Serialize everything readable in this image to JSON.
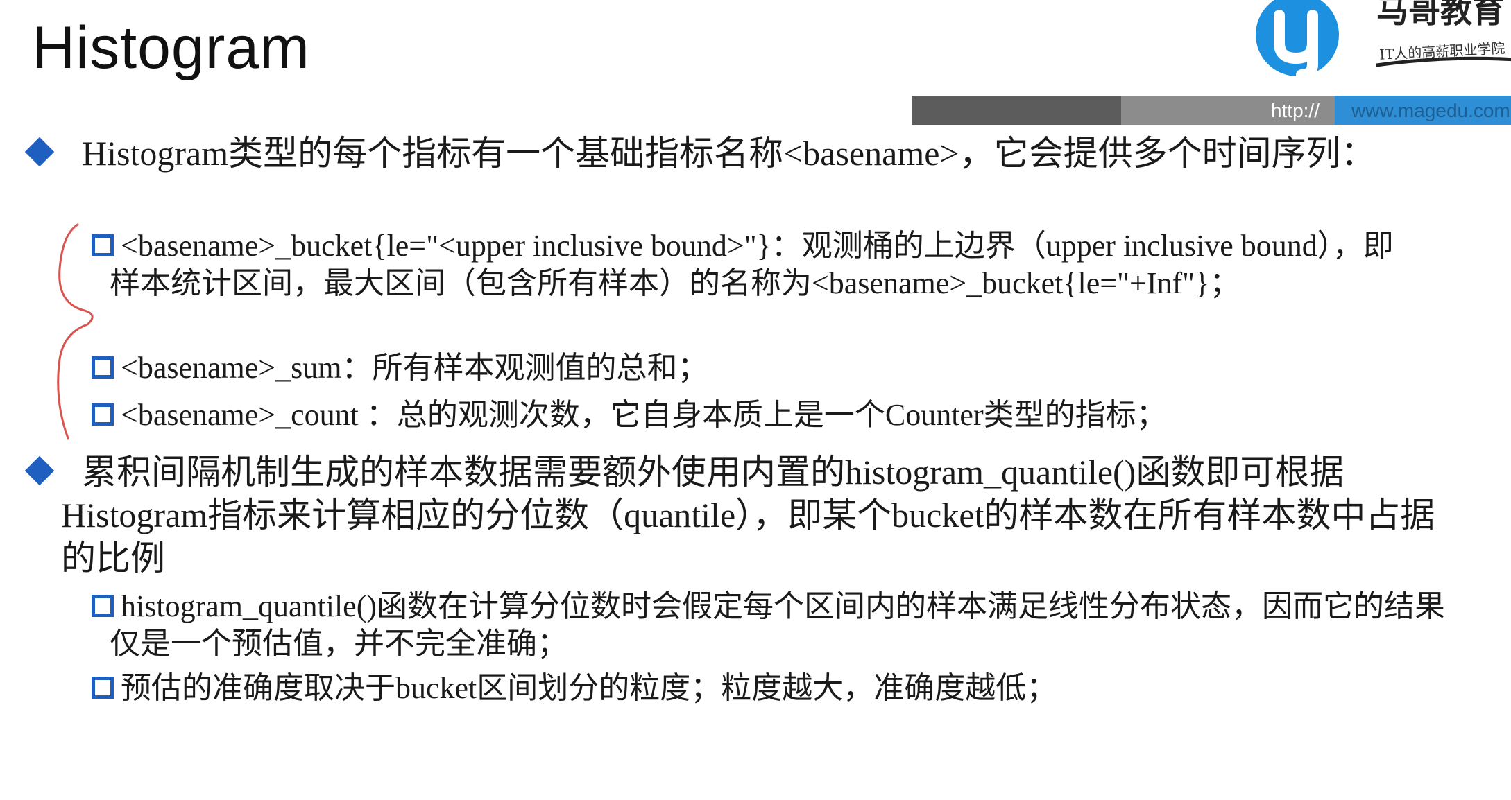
{
  "slide": {
    "title": "Histogram"
  },
  "logo": {
    "name": "马哥教育",
    "slogan": "IT人的高薪职业学院",
    "icon": "magedu-logo-icon"
  },
  "url_bar": {
    "prefix": "http://",
    "site": "www.magedu.com"
  },
  "bullets": [
    {
      "text": "Histogram类型的每个指标有一个基础指标名称<basename>，它会提供多个时间序列：",
      "children": [
        {
          "text": "<basename>_bucket{le=\"<upper inclusive bound>\"}：观测桶的上边界（upper inclusive bound），即样本统计区间，最大区间（包含所有样本）的名称为<basename>_bucket{le=\"+Inf\"}；"
        },
        {
          "text": "<basename>_sum：所有样本观测值的总和；"
        },
        {
          "text": "<basename>_count ：总的观测次数，它自身本质上是一个Counter类型的指标；"
        }
      ]
    },
    {
      "text": "累积间隔机制生成的样本数据需要额外使用内置的histogram_quantile()函数即可根据Histogram指标来计算相应的分位数（quantile），即某个bucket的样本数在所有样本数中占据的比例",
      "children": [
        {
          "text": "histogram_quantile()函数在计算分位数时会假定每个区间内的样本满足线性分布状态，因而它的结果仅是一个预估值，并不完全准确；"
        },
        {
          "text": "预估的准确度取决于bucket区间划分的粒度；粒度越大，准确度越低；"
        }
      ]
    }
  ],
  "colors": {
    "bullet_blue": "#1f5fbf",
    "brace_red": "#d9534f",
    "url_blue": "#2f8fd6"
  }
}
